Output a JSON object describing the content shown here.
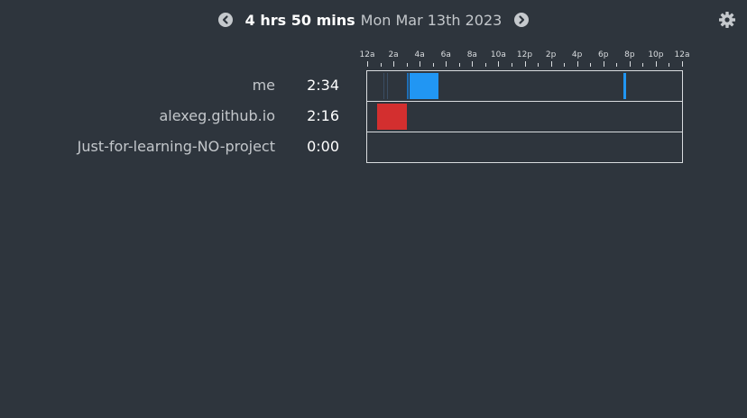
{
  "header": {
    "total": "4 hrs 50 mins",
    "date": "Mon Mar 13th 2023",
    "prev_icon": "chevron-left-circle-icon",
    "next_icon": "chevron-right-circle-icon",
    "settings_icon": "gear-icon"
  },
  "timeline": {
    "ticks": [
      "12a",
      "2a",
      "4a",
      "6a",
      "8a",
      "10a",
      "12p",
      "2p",
      "4p",
      "6p",
      "8p",
      "10p",
      "12a"
    ],
    "hours_span": 24
  },
  "rows": [
    {
      "name": "me",
      "time": "2:34",
      "color": "#2196f3",
      "segments": [
        {
          "start": 1.25,
          "end": 1.3,
          "color": "#3a4d63"
        },
        {
          "start": 1.5,
          "end": 1.55,
          "color": "#3a4d63"
        },
        {
          "start": 3.05,
          "end": 3.15,
          "color": "#1e6fb8"
        },
        {
          "start": 3.2,
          "end": 5.4,
          "color": "#2196f3"
        },
        {
          "start": 19.5,
          "end": 19.75,
          "color": "#2196f3"
        }
      ]
    },
    {
      "name": "alexeg.github.io",
      "time": "2:16",
      "color": "#d32f2f",
      "segments": [
        {
          "start": 0.75,
          "end": 3.05,
          "color": "#d32f2f"
        }
      ]
    },
    {
      "name": "Just-for-learning-NO-project",
      "time": "0:00",
      "color": "#999999",
      "segments": []
    }
  ]
}
